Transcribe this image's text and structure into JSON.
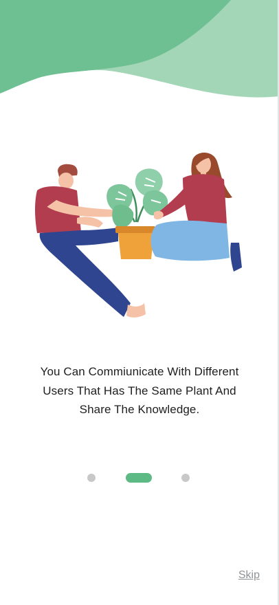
{
  "onboarding": {
    "message": "You Can Commiunicate With Different Users That Has The Same Plant And Share The Knowledge.",
    "skip_label": "Skip",
    "pager": {
      "total_pages": 3,
      "current_page": 2
    },
    "illustration": "two people sharing a potted plant"
  },
  "colors": {
    "accent_green": "#5dba84",
    "wave_dark": "#6cbf8f",
    "wave_light": "#9fd5b4",
    "pager_inactive": "#c8c8c8"
  }
}
